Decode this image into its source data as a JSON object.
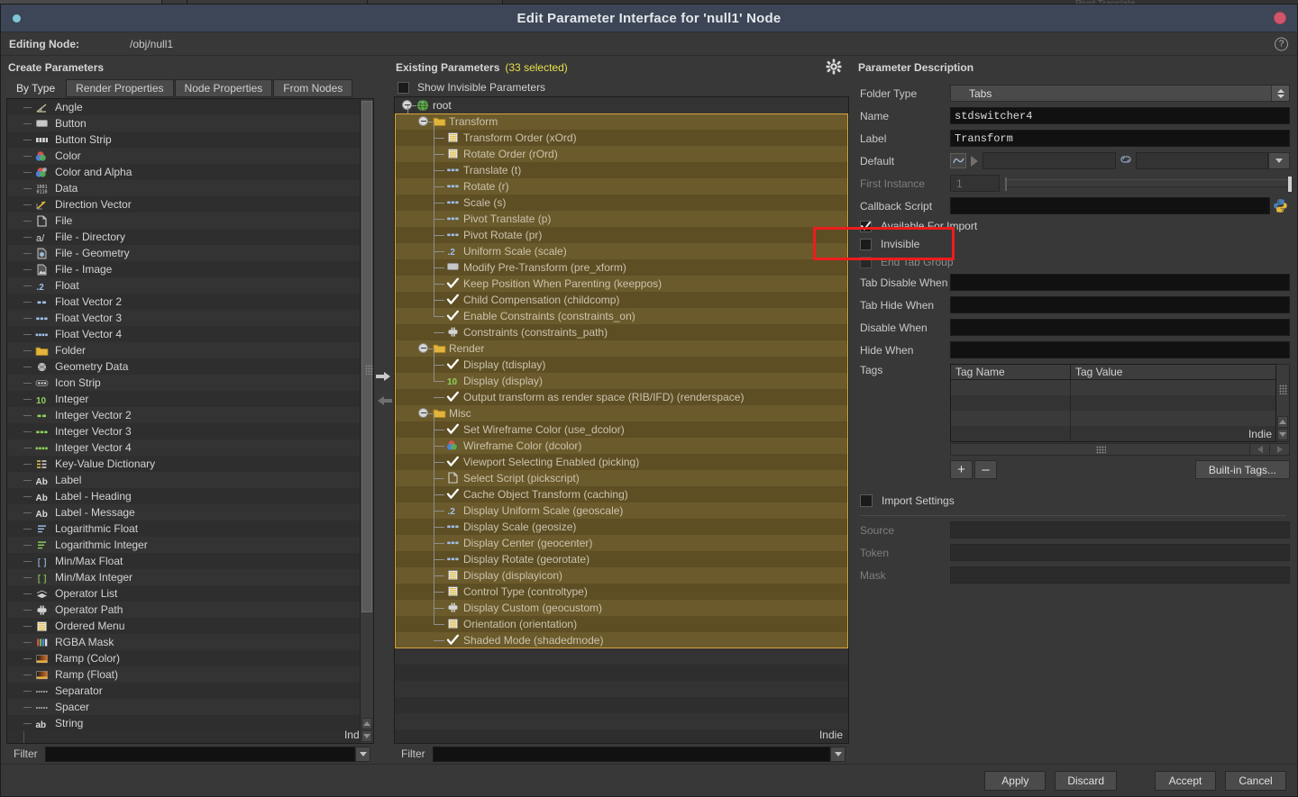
{
  "window": {
    "title": "Edit Parameter Interface for 'null1' Node",
    "close_label": "close",
    "ghost_background_label": "Pivot Translate"
  },
  "editing_node": {
    "label": "Editing Node:",
    "value": "/obj/null1"
  },
  "help": {
    "glyph": "?"
  },
  "create_parameters": {
    "title": "Create Parameters",
    "tabs": [
      {
        "label": "By Type",
        "active": true
      },
      {
        "label": "Render Properties",
        "active": false
      },
      {
        "label": "Node Properties",
        "active": false
      },
      {
        "label": "From Nodes",
        "active": false
      }
    ],
    "types": [
      {
        "label": "Angle",
        "icon": "angle-icon"
      },
      {
        "label": "Button",
        "icon": "button-icon"
      },
      {
        "label": "Button Strip",
        "icon": "button-strip-icon"
      },
      {
        "label": "Color",
        "icon": "color-icon"
      },
      {
        "label": "Color and Alpha",
        "icon": "color-alpha-icon"
      },
      {
        "label": "Data",
        "icon": "data-icon"
      },
      {
        "label": "Direction Vector",
        "icon": "direction-vector-icon"
      },
      {
        "label": "File",
        "icon": "file-icon"
      },
      {
        "label": "File - Directory",
        "icon": "file-directory-icon"
      },
      {
        "label": "File - Geometry",
        "icon": "file-geometry-icon"
      },
      {
        "label": "File - Image",
        "icon": "file-image-icon"
      },
      {
        "label": "Float",
        "icon": "float-icon"
      },
      {
        "label": "Float Vector 2",
        "icon": "float-vector2-icon"
      },
      {
        "label": "Float Vector 3",
        "icon": "float-vector3-icon"
      },
      {
        "label": "Float Vector 4",
        "icon": "float-vector4-icon"
      },
      {
        "label": "Folder",
        "icon": "folder-icon"
      },
      {
        "label": "Geometry Data",
        "icon": "geometry-data-icon"
      },
      {
        "label": "Icon Strip",
        "icon": "icon-strip-icon"
      },
      {
        "label": "Integer",
        "icon": "integer-icon"
      },
      {
        "label": "Integer Vector 2",
        "icon": "int-vector2-icon"
      },
      {
        "label": "Integer Vector 3",
        "icon": "int-vector3-icon"
      },
      {
        "label": "Integer Vector 4",
        "icon": "int-vector4-icon"
      },
      {
        "label": "Key-Value Dictionary",
        "icon": "key-value-dict-icon"
      },
      {
        "label": "Label",
        "icon": "label-icon"
      },
      {
        "label": "Label - Heading",
        "icon": "label-heading-icon"
      },
      {
        "label": "Label - Message",
        "icon": "label-message-icon"
      },
      {
        "label": "Logarithmic Float",
        "icon": "log-float-icon"
      },
      {
        "label": "Logarithmic Integer",
        "icon": "log-integer-icon"
      },
      {
        "label": "Min/Max Float",
        "icon": "minmax-float-icon"
      },
      {
        "label": "Min/Max Integer",
        "icon": "minmax-integer-icon"
      },
      {
        "label": "Operator List",
        "icon": "operator-list-icon"
      },
      {
        "label": "Operator Path",
        "icon": "operator-path-icon"
      },
      {
        "label": "Ordered Menu",
        "icon": "ordered-menu-icon"
      },
      {
        "label": "RGBA Mask",
        "icon": "rgba-mask-icon"
      },
      {
        "label": "Ramp (Color)",
        "icon": "ramp-color-icon"
      },
      {
        "label": "Ramp (Float)",
        "icon": "ramp-float-icon"
      },
      {
        "label": "Separator",
        "icon": "separator-icon"
      },
      {
        "label": "Spacer",
        "icon": "spacer-icon"
      },
      {
        "label": "String",
        "icon": "string-icon"
      }
    ],
    "watermark": "Indie",
    "filter": {
      "label": "Filter",
      "value": "",
      "placeholder": ""
    }
  },
  "transfer": {
    "add_label": "add-to-existing",
    "remove_label": "remove-from-existing"
  },
  "existing_parameters": {
    "title": "Existing Parameters",
    "count_text": "(33 selected)",
    "gear_label": "options",
    "show_invisible": {
      "label": "Show Invisible Parameters",
      "checked": false
    },
    "root_label": "root",
    "tree": [
      {
        "label": "Transform",
        "icon": "folder-icon",
        "depth": 1,
        "folder": true,
        "selected": true
      },
      {
        "label": "Transform Order (xOrd)",
        "icon": "ordered-menu-icon",
        "depth": 2,
        "selected": true
      },
      {
        "label": "Rotate Order (rOrd)",
        "icon": "ordered-menu-icon",
        "depth": 2,
        "selected": true
      },
      {
        "label": "Translate (t)",
        "icon": "float-vector3-icon",
        "depth": 2,
        "selected": true
      },
      {
        "label": "Rotate (r)",
        "icon": "float-vector3-icon",
        "depth": 2,
        "selected": true
      },
      {
        "label": "Scale (s)",
        "icon": "float-vector3-icon",
        "depth": 2,
        "selected": true
      },
      {
        "label": "Pivot Translate (p)",
        "icon": "float-vector3-icon",
        "depth": 2,
        "selected": true
      },
      {
        "label": "Pivot Rotate (pr)",
        "icon": "float-vector3-icon",
        "depth": 2,
        "selected": true
      },
      {
        "label": "Uniform Scale (scale)",
        "icon": "float-icon",
        "depth": 2,
        "selected": true
      },
      {
        "label": "Modify Pre-Transform (pre_xform)",
        "icon": "button-icon",
        "depth": 2,
        "selected": true
      },
      {
        "label": "Keep Position When Parenting (keeppos)",
        "icon": "toggle-icon",
        "depth": 2,
        "selected": true
      },
      {
        "label": "Child Compensation (childcomp)",
        "icon": "toggle-icon",
        "depth": 2,
        "selected": true
      },
      {
        "label": "Enable Constraints (constraints_on)",
        "icon": "toggle-icon",
        "depth": 2,
        "selected": true
      },
      {
        "label": "Constraints (constraints_path)",
        "icon": "operator-path-icon",
        "depth": 2,
        "selected": true
      },
      {
        "label": "Render",
        "icon": "folder-icon",
        "depth": 1,
        "folder": true,
        "selected": true
      },
      {
        "label": "Display (tdisplay)",
        "icon": "toggle-icon",
        "depth": 2,
        "selected": true
      },
      {
        "label": "Display (display)",
        "icon": "integer-icon",
        "depth": 2,
        "selected": true
      },
      {
        "label": "Output transform as render space (RIB/IFD) (renderspace)",
        "icon": "toggle-icon",
        "depth": 2,
        "selected": true
      },
      {
        "label": "Misc",
        "icon": "folder-icon",
        "depth": 1,
        "folder": true,
        "selected": true
      },
      {
        "label": "Set Wireframe Color (use_dcolor)",
        "icon": "toggle-icon",
        "depth": 2,
        "selected": true
      },
      {
        "label": "Wireframe Color (dcolor)",
        "icon": "color-icon",
        "depth": 2,
        "selected": true
      },
      {
        "label": "Viewport Selecting Enabled (picking)",
        "icon": "toggle-icon",
        "depth": 2,
        "selected": true
      },
      {
        "label": "Select Script (pickscript)",
        "icon": "file-icon",
        "depth": 2,
        "selected": true
      },
      {
        "label": "Cache Object Transform (caching)",
        "icon": "toggle-icon",
        "depth": 2,
        "selected": true
      },
      {
        "label": "Display Uniform Scale (geoscale)",
        "icon": "float-icon",
        "depth": 2,
        "selected": true
      },
      {
        "label": "Display Scale (geosize)",
        "icon": "float-vector3-icon",
        "depth": 2,
        "selected": true
      },
      {
        "label": "Display Center (geocenter)",
        "icon": "float-vector3-icon",
        "depth": 2,
        "selected": true
      },
      {
        "label": "Display Rotate (georotate)",
        "icon": "float-vector3-icon",
        "depth": 2,
        "selected": true
      },
      {
        "label": "Display (displayicon)",
        "icon": "ordered-menu-icon",
        "depth": 2,
        "selected": true
      },
      {
        "label": "Control Type (controltype)",
        "icon": "ordered-menu-icon",
        "depth": 2,
        "selected": true
      },
      {
        "label": "Display Custom (geocustom)",
        "icon": "operator-path-icon",
        "depth": 2,
        "selected": true
      },
      {
        "label": "Orientation (orientation)",
        "icon": "ordered-menu-icon",
        "depth": 2,
        "selected": true
      },
      {
        "label": "Shaded Mode (shadedmode)",
        "icon": "toggle-icon",
        "depth": 2,
        "selected": true
      }
    ],
    "watermark": "Indie",
    "filter": {
      "label": "Filter",
      "value": "",
      "placeholder": ""
    }
  },
  "parameter_description": {
    "title": "Parameter Description",
    "folder_type": {
      "label": "Folder Type",
      "value": "Tabs"
    },
    "name": {
      "label": "Name",
      "value": "stdswitcher4"
    },
    "label_field": {
      "label": "Label",
      "value": "Transform"
    },
    "default": {
      "label": "Default",
      "value": "",
      "expr_value": ""
    },
    "first_instance": {
      "label": "First Instance",
      "value": "1",
      "disabled": true
    },
    "callback_script": {
      "label": "Callback Script",
      "value": "",
      "lang_icon": "python-icon"
    },
    "checkboxes": [
      {
        "label": "Available For Import",
        "checked": true,
        "disabled": false
      },
      {
        "label": "Invisible",
        "checked": false,
        "disabled": false
      },
      {
        "label": "End Tab Group",
        "checked": false,
        "disabled": true
      }
    ],
    "conditionals": [
      {
        "label": "Tab Disable When",
        "value": ""
      },
      {
        "label": "Tab Hide When",
        "value": ""
      },
      {
        "label": "Disable When",
        "value": ""
      },
      {
        "label": "Hide When",
        "value": ""
      }
    ],
    "tags": {
      "label": "Tags",
      "columns": [
        "Tag Name",
        "Tag Value"
      ],
      "rows": [],
      "watermark": "Indie",
      "add_label": "+",
      "remove_label": "–",
      "builtin_label": "Built-in Tags..."
    },
    "import_settings": {
      "label": "Import Settings",
      "checked": false,
      "fields": [
        {
          "label": "Source",
          "value": ""
        },
        {
          "label": "Token",
          "value": ""
        },
        {
          "label": "Mask",
          "value": ""
        }
      ]
    }
  },
  "annotation": {
    "target": "invisible-checkbox-row",
    "color": "#ee1c1c"
  },
  "footer": {
    "buttons": [
      {
        "label": "Apply"
      },
      {
        "label": "Discard"
      },
      {
        "label": "Accept"
      },
      {
        "label": "Cancel"
      }
    ]
  }
}
